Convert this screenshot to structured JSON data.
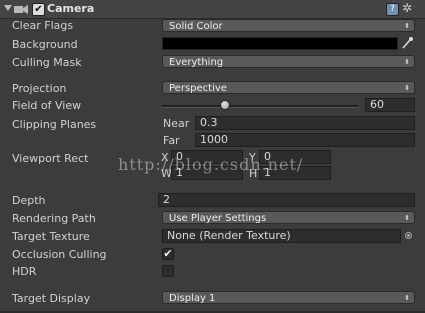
{
  "component": {
    "title": "Camera",
    "enabled": "✔"
  },
  "clear_flags": {
    "label": "Clear Flags",
    "value": "Solid Color"
  },
  "background": {
    "label": "Background",
    "color": "#000000"
  },
  "culling_mask": {
    "label": "Culling Mask",
    "value": "Everything"
  },
  "projection": {
    "label": "Projection",
    "value": "Perspective"
  },
  "field_of_view": {
    "label": "Field of View",
    "value": "60",
    "fraction": 0.32
  },
  "clipping_planes": {
    "label": "Clipping Planes",
    "near_label": "Near",
    "near": "0.3",
    "far_label": "Far",
    "far": "1000"
  },
  "viewport_rect": {
    "label": "Viewport Rect",
    "x_label": "X",
    "x": "0",
    "y_label": "Y",
    "y": "0",
    "w_label": "W",
    "w": "1",
    "h_label": "H",
    "h": "1"
  },
  "depth": {
    "label": "Depth",
    "value": "2"
  },
  "rendering_path": {
    "label": "Rendering Path",
    "value": "Use Player Settings"
  },
  "target_texture": {
    "label": "Target Texture",
    "value": "None (Render Texture)"
  },
  "occlusion_culling": {
    "label": "Occlusion Culling",
    "checked": "✔"
  },
  "hdr": {
    "label": "HDR",
    "checked": ""
  },
  "target_display": {
    "label": "Target Display",
    "value": "Display 1"
  },
  "dropdown_arrow": "⬍",
  "watermark": "http://blog.csdn.net/"
}
